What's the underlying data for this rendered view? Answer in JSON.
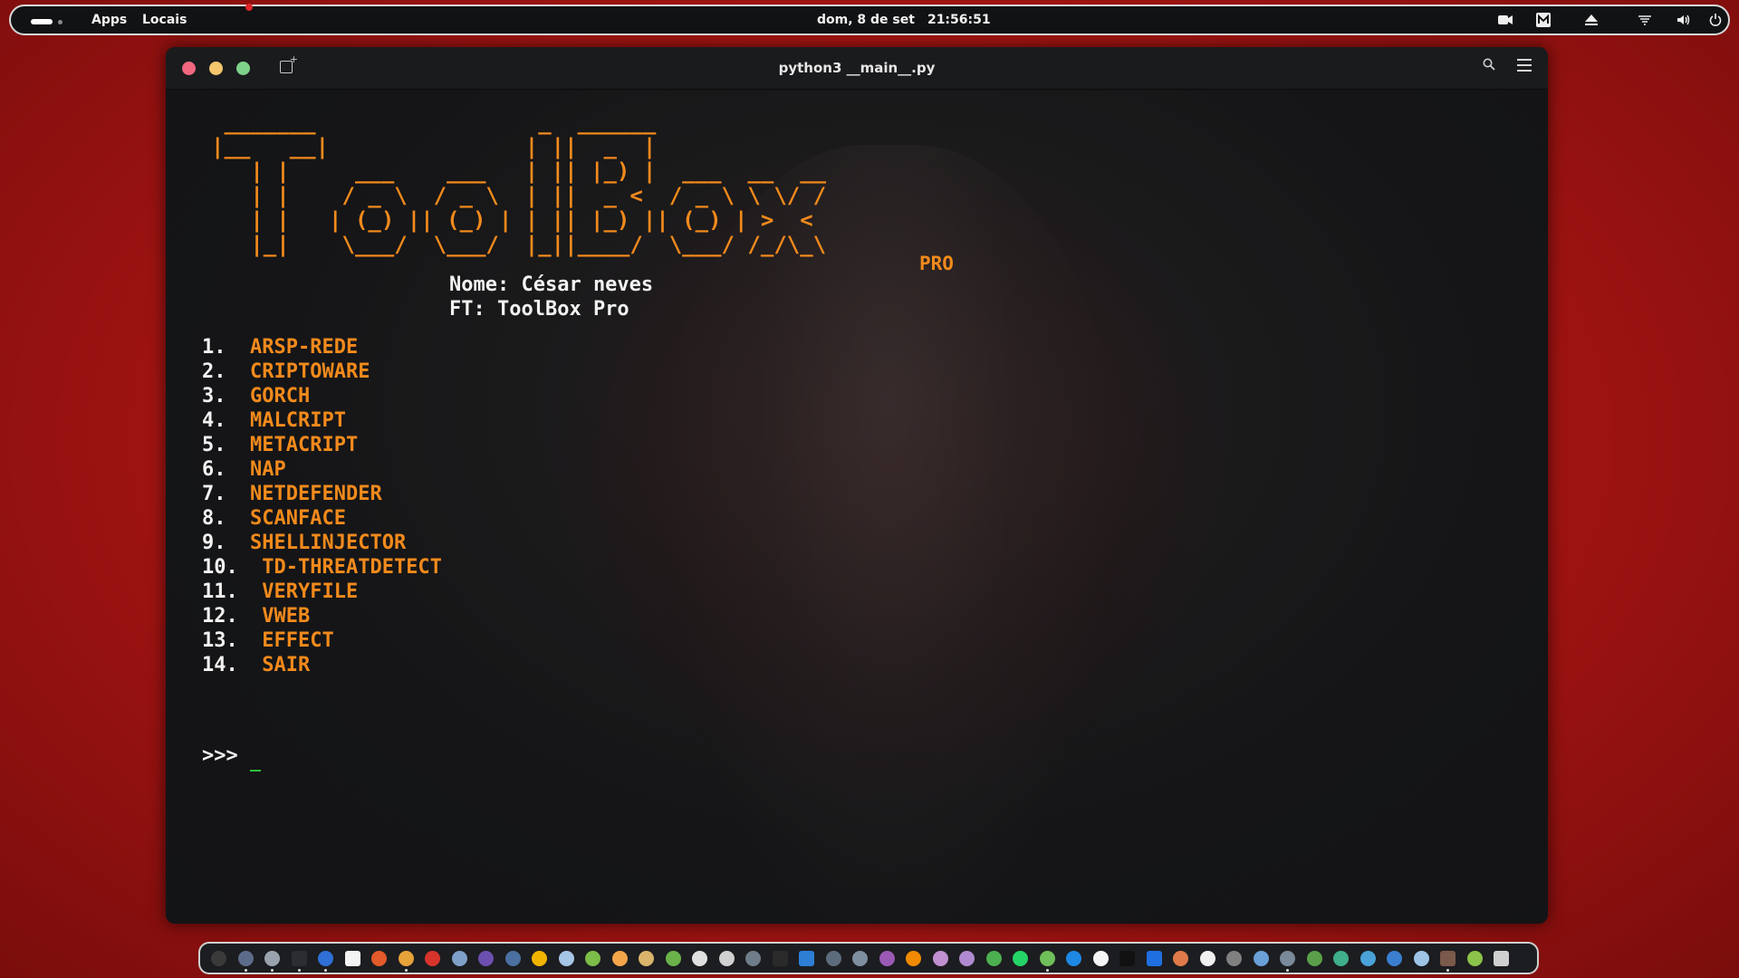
{
  "topbar": {
    "apps_label": "Apps",
    "places_label": "Locais",
    "date": "dom, 8 de set",
    "time": "21:56:51"
  },
  "window": {
    "title": "python3 __main__.py"
  },
  "terminal": {
    "ascii_banner": " _______                 _  ______\n|__   __|               | ||  _  |\n   | |     ___    ___   | || |_) |  ___  __  __\n   | |    / _ \\  / _ \\  | ||  _ <  / _ \\ \\ \\/ /\n   | |   | (_) || (_) | | || |_) || (_) | >  <\n   |_|    \\___/  \\___/  |_||____/  \\___/ /_/\\_\\",
    "pro_tag": "PRO",
    "name_line": "Nome: César neves",
    "ft_line": "FT: ToolBox Pro",
    "menu": [
      {
        "num": "1.",
        "label": "ARSP-REDE"
      },
      {
        "num": "2.",
        "label": "CRIPTOWARE"
      },
      {
        "num": "3.",
        "label": "GORCH"
      },
      {
        "num": "4.",
        "label": "MALCRIPT"
      },
      {
        "num": "5.",
        "label": "METACRIPT"
      },
      {
        "num": "6.",
        "label": "NAP"
      },
      {
        "num": "7.",
        "label": "NETDEFENDER"
      },
      {
        "num": "8.",
        "label": "SCANFACE"
      },
      {
        "num": "9.",
        "label": "SHELLINJECTOR"
      },
      {
        "num": "10.",
        "label": "TD-THREATDETECT"
      },
      {
        "num": "11.",
        "label": "VERYFILE"
      },
      {
        "num": "12.",
        "label": "VWEB"
      },
      {
        "num": "13.",
        "label": "EFFECT"
      },
      {
        "num": "14.",
        "label": "SAIR"
      }
    ],
    "prompt": ">>>"
  },
  "colors": {
    "accent_orange": "#f28a1c",
    "desktop_red": "#b3181a",
    "cursor_green": "#2fbf3a"
  },
  "tray_icons": [
    "camera-icon",
    "m-app-icon",
    "eject-icon",
    "wifi-icon",
    "volume-icon",
    "power-icon"
  ],
  "dock_icons": [
    "dock-app-1",
    "dock-app-2",
    "dock-app-3",
    "dock-app-4",
    "dock-app-5",
    "dock-app-6",
    "dock-app-7",
    "dock-app-8",
    "dock-app-9",
    "dock-app-10",
    "dock-app-11",
    "dock-app-12",
    "dock-app-13",
    "dock-app-14",
    "dock-app-15",
    "dock-app-16",
    "dock-app-17",
    "dock-app-18",
    "dock-app-19",
    "dock-app-20",
    "dock-app-21",
    "dock-app-22",
    "dock-app-23",
    "dock-app-24",
    "dock-app-25",
    "dock-app-26",
    "dock-app-27",
    "dock-app-28",
    "dock-app-29",
    "dock-app-30",
    "dock-app-31",
    "dock-app-32",
    "dock-app-33",
    "dock-app-34",
    "dock-app-35",
    "dock-app-36",
    "dock-app-37",
    "dock-app-38",
    "dock-app-39",
    "dock-app-40",
    "dock-app-41",
    "dock-app-42",
    "dock-app-43",
    "dock-app-44",
    "dock-app-45",
    "dock-app-46",
    "dock-app-47",
    "dock-app-48",
    "trash-icon"
  ]
}
